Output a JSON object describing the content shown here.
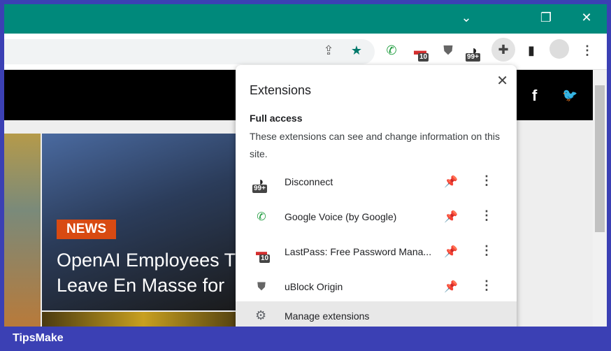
{
  "window": {
    "controls": [
      "chevron-down",
      "restore",
      "close"
    ]
  },
  "toolbar": {
    "extension_badges": {
      "lastpass": "10",
      "disconnect": "99+"
    }
  },
  "page": {
    "tag": "NEWS",
    "headline_line1": "OpenAI Employees T",
    "headline_line2": "Leave En Masse for"
  },
  "popup": {
    "title": "Extensions",
    "section": "Full access",
    "description": "These extensions can see and change information on this site.",
    "extensions": [
      {
        "name": "Disconnect",
        "badge": "99+"
      },
      {
        "name": "Google Voice (by Google)",
        "badge": ""
      },
      {
        "name": "LastPass: Free Password Mana...",
        "badge": "10"
      },
      {
        "name": "uBlock Origin",
        "badge": ""
      }
    ],
    "manage": "Manage extensions"
  },
  "brand": "TipsMake",
  "colors": {
    "titlebar": "#00897b",
    "accent": "#00796b",
    "frame": "#3b40b4",
    "news": "#d84a12"
  }
}
